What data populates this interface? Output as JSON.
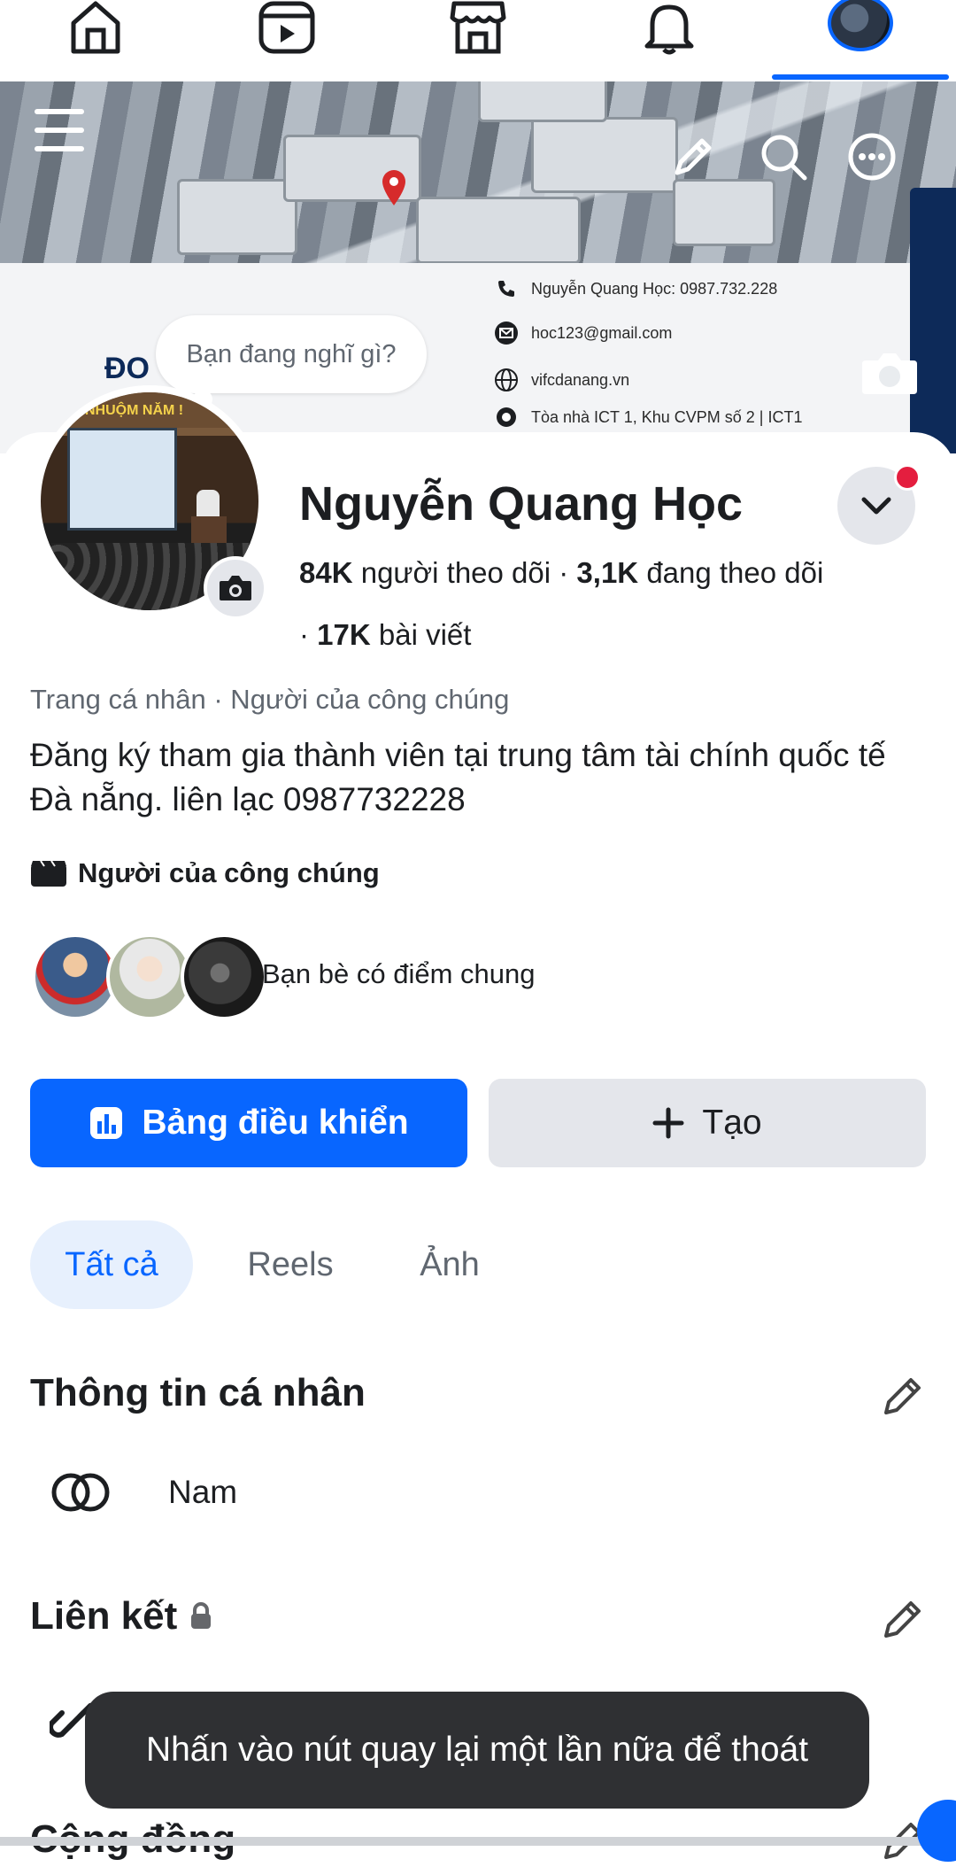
{
  "nav": {
    "items": [
      {
        "name": "home-icon"
      },
      {
        "name": "reels-icon"
      },
      {
        "name": "marketplace-icon"
      },
      {
        "name": "notifications-icon"
      },
      {
        "name": "profile-avatar"
      }
    ],
    "active_index": 4
  },
  "cover": {
    "contact_lines": [
      "Nguyễn Quang Học: 0987.732.228",
      "hoc123@gmail.com",
      "vifcdanang.vn",
      "Tòa nhà ICT 1, Khu CVPM số 2 | ICT1"
    ],
    "partial_text": "ĐO",
    "banner_text": "NHUỘM NĂM !"
  },
  "composer": {
    "placeholder": "Bạn đang nghĩ gì?"
  },
  "profile": {
    "name": "Nguyễn Quang Học",
    "followers_count": "84K",
    "followers_label": "người theo dõi",
    "following_count": "3,1K",
    "following_label": "đang theo dõi",
    "posts_count": "17K",
    "posts_label": "bài viết",
    "sep": " · ",
    "category": "Trang cá nhân · Người của công chúng",
    "bio": "Đăng ký tham gia thành viên tại trung tâm tài chính quốc tế Đà nẵng. liên lạc 0987732228",
    "public_figure": "Người của công chúng",
    "mutual_friends": "Bạn bè có điểm chung"
  },
  "actions": {
    "dashboard": "Bảng điều khiển",
    "create": "Tạo"
  },
  "tabs": [
    "Tất cả",
    "Reels",
    "Ảnh"
  ],
  "sections": {
    "personal_info": "Thông tin cá nhân",
    "gender": "Nam",
    "links": "Liên kết",
    "community": "Cộng đồng"
  },
  "toast": "Nhấn vào nút quay lại một lần nữa để thoát",
  "colors": {
    "accent": "#0866ff",
    "notification": "#e41e3f"
  }
}
